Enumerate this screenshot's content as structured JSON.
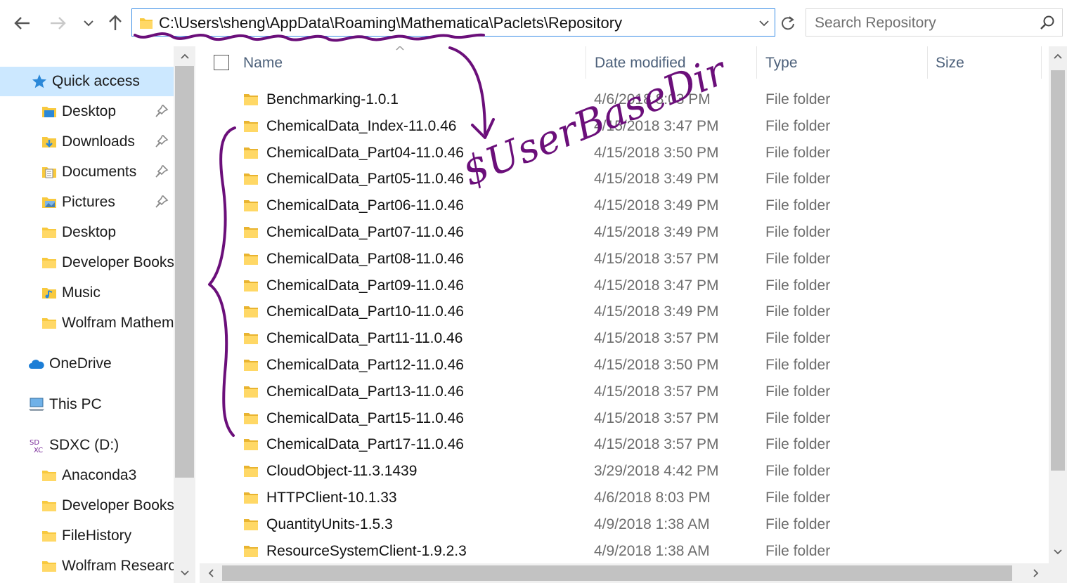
{
  "toolbar": {
    "back_icon": "arrow-left-icon",
    "forward_icon": "arrow-right-icon",
    "recent_icon": "chevron-down-icon",
    "up_icon": "arrow-up-icon",
    "address": "C:\\Users\\sheng\\AppData\\Roaming\\Mathematica\\Paclets\\Repository",
    "refresh_icon": "refresh-icon",
    "search_placeholder": "Search Repository"
  },
  "sidebar": {
    "items": [
      {
        "label": "Quick access",
        "icon": "star-icon",
        "selected": true
      },
      {
        "label": "Desktop",
        "icon": "desktop-folder-icon",
        "pinned": true
      },
      {
        "label": "Downloads",
        "icon": "downloads-folder-icon",
        "pinned": true
      },
      {
        "label": "Documents",
        "icon": "documents-folder-icon",
        "pinned": true
      },
      {
        "label": "Pictures",
        "icon": "pictures-folder-icon",
        "pinned": true
      },
      {
        "label": "Desktop",
        "icon": "folder-icon"
      },
      {
        "label": "Developer Books",
        "icon": "folder-icon"
      },
      {
        "label": "Music",
        "icon": "music-folder-icon"
      },
      {
        "label": "Wolfram Mathem",
        "icon": "folder-icon"
      },
      {
        "label": "OneDrive",
        "icon": "cloud-icon"
      },
      {
        "label": "This PC",
        "icon": "computer-icon"
      },
      {
        "label": "SDXC (D:)",
        "icon": "sd-card-icon"
      },
      {
        "label": "Anaconda3",
        "icon": "folder-icon"
      },
      {
        "label": "Developer Books",
        "icon": "folder-icon"
      },
      {
        "label": "FileHistory",
        "icon": "folder-icon"
      },
      {
        "label": "Wolfram Researc",
        "icon": "folder-icon"
      }
    ]
  },
  "columns": {
    "name": "Name",
    "date": "Date modified",
    "type": "Type",
    "size": "Size"
  },
  "files": [
    {
      "name": "Benchmarking-1.0.1",
      "date": "4/6/2018 8:03 PM",
      "type": "File folder"
    },
    {
      "name": "ChemicalData_Index-11.0.46",
      "date": "4/15/2018 3:47 PM",
      "type": "File folder"
    },
    {
      "name": "ChemicalData_Part04-11.0.46",
      "date": "4/15/2018 3:50 PM",
      "type": "File folder"
    },
    {
      "name": "ChemicalData_Part05-11.0.46",
      "date": "4/15/2018 3:49 PM",
      "type": "File folder"
    },
    {
      "name": "ChemicalData_Part06-11.0.46",
      "date": "4/15/2018 3:49 PM",
      "type": "File folder"
    },
    {
      "name": "ChemicalData_Part07-11.0.46",
      "date": "4/15/2018 3:49 PM",
      "type": "File folder"
    },
    {
      "name": "ChemicalData_Part08-11.0.46",
      "date": "4/15/2018 3:57 PM",
      "type": "File folder"
    },
    {
      "name": "ChemicalData_Part09-11.0.46",
      "date": "4/15/2018 3:47 PM",
      "type": "File folder"
    },
    {
      "name": "ChemicalData_Part10-11.0.46",
      "date": "4/15/2018 3:49 PM",
      "type": "File folder"
    },
    {
      "name": "ChemicalData_Part11-11.0.46",
      "date": "4/15/2018 3:57 PM",
      "type": "File folder"
    },
    {
      "name": "ChemicalData_Part12-11.0.46",
      "date": "4/15/2018 3:50 PM",
      "type": "File folder"
    },
    {
      "name": "ChemicalData_Part13-11.0.46",
      "date": "4/15/2018 3:57 PM",
      "type": "File folder"
    },
    {
      "name": "ChemicalData_Part15-11.0.46",
      "date": "4/15/2018 3:57 PM",
      "type": "File folder"
    },
    {
      "name": "ChemicalData_Part17-11.0.46",
      "date": "4/15/2018 3:57 PM",
      "type": "File folder"
    },
    {
      "name": "CloudObject-11.3.1439",
      "date": "3/29/2018 4:42 PM",
      "type": "File folder"
    },
    {
      "name": "HTTPClient-10.1.33",
      "date": "4/6/2018 8:03 PM",
      "type": "File folder"
    },
    {
      "name": "QuantityUnits-1.5.3",
      "date": "4/9/2018 1:38 AM",
      "type": "File folder"
    },
    {
      "name": "ResourceSystemClient-1.9.2.3",
      "date": "4/9/2018 1:38 AM",
      "type": "File folder"
    }
  ],
  "annotation": {
    "handwritten_text": "$UserBaseDir",
    "ink_color": "#6b0f7a"
  },
  "colors": {
    "folder": "#f8c93e",
    "selection": "#cce8ff",
    "address_border": "#3a8ee6"
  }
}
